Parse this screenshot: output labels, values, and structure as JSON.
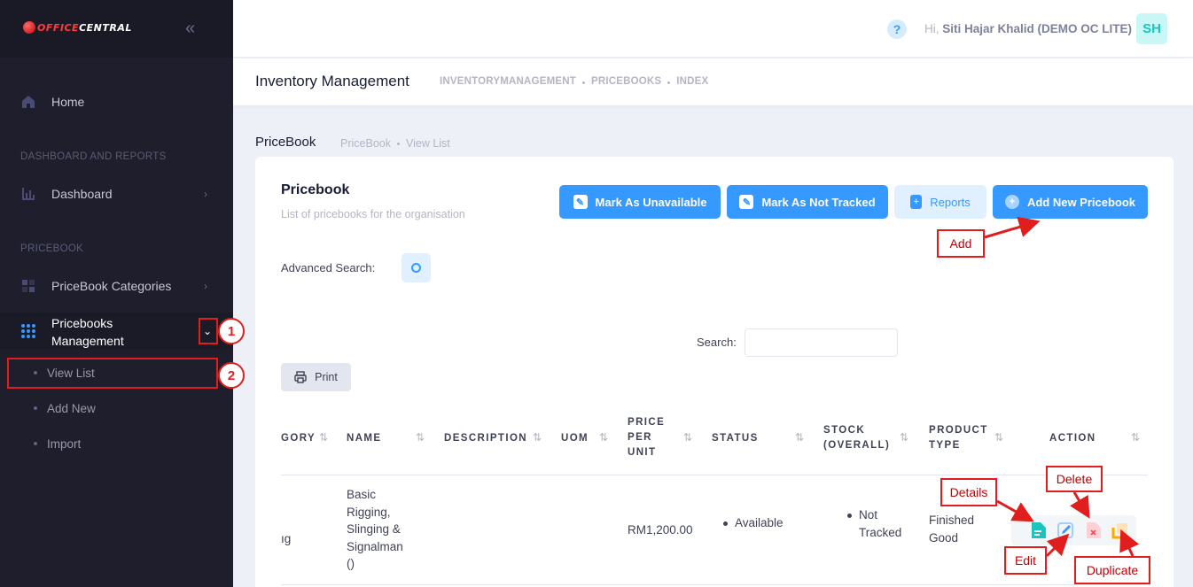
{
  "app": {
    "logo_text_a": "OFFICE",
    "logo_text_b": "CENTRAL"
  },
  "sidebar": {
    "home": "Home",
    "section_dashboard": "DASHBOARD AND REPORTS",
    "dashboard": "Dashboard",
    "section_pricebook": "PRICEBOOK",
    "categories": "PriceBook Categories",
    "management_line1": "Pricebooks",
    "management_line2": "Management",
    "sub_items": [
      "View List",
      "Add New",
      "Import"
    ]
  },
  "annotations": {
    "step1": "1",
    "step2": "2",
    "add": "Add",
    "details": "Details",
    "delete": "Delete",
    "edit": "Edit",
    "duplicate": "Duplicate",
    "arrow_color": "#e01e1e"
  },
  "topbar": {
    "greeting": "Hi,",
    "user": "Siti Hajar Khalid (DEMO OC LITE)",
    "initials": "SH",
    "help": "?"
  },
  "subheader": {
    "title": "Inventory Management",
    "crumbs": [
      "INVENTORYMANAGEMENT",
      "PRICEBOOKS",
      "INDEX"
    ]
  },
  "page": {
    "title": "PriceBook",
    "crumbs": [
      "PriceBook",
      "View List"
    ]
  },
  "card": {
    "title": "Pricebook",
    "subtitle": "List of pricebooks for the organisation",
    "buttons": {
      "mark_unavailable": "Mark As Unavailable",
      "mark_not_tracked": "Mark As Not Tracked",
      "reports": "Reports",
      "add_new": "Add New Pricebook"
    },
    "advanced_search": "Advanced Search:",
    "search_label": "Search:",
    "search_value": "",
    "print": "Print"
  },
  "table": {
    "columns": {
      "category": "GORY",
      "name": "NAME",
      "description": "DESCRIPTION",
      "uom": "UOM",
      "price_l1": "PRICE",
      "price_l2": "PER",
      "price_l3": "UNIT",
      "status": "STATUS",
      "stock_l1": "STOCK",
      "stock_l2": "(OVERALL)",
      "type_l1": "PRODUCT",
      "type_l2": "TYPE",
      "action": "ACTION"
    },
    "row": {
      "category": "ıg",
      "name_lines": [
        "Basic",
        "Rigging,",
        "Slinging &",
        "Signalman",
        "()"
      ],
      "price": "RM1,200.00",
      "status": "Available",
      "stock_l1": "Not",
      "stock_l2": "Tracked",
      "type_l1": "Finished",
      "type_l2": "Good"
    }
  },
  "colors": {
    "primary": "#3699ff",
    "sidebar": "#1e1e2d",
    "annotation": "#e01e1e"
  }
}
